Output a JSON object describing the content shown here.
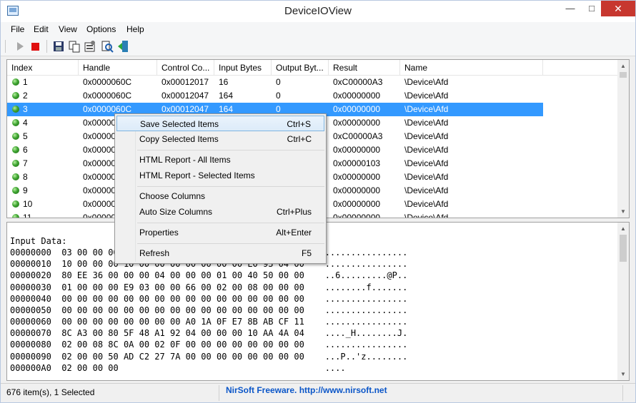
{
  "window": {
    "title": "DeviceIOView"
  },
  "menu": [
    "File",
    "Edit",
    "View",
    "Options",
    "Help"
  ],
  "toolbar": {
    "buttons": [
      "play-icon",
      "stop-icon",
      "save-icon",
      "copy-icon",
      "properties-icon",
      "find-icon",
      "exit-icon"
    ]
  },
  "list": {
    "columns": [
      "Index",
      "Handle",
      "Control Co...",
      "Input Bytes",
      "Output Byt...",
      "Result",
      "Name"
    ],
    "rows": [
      {
        "index": "1",
        "handle": "0x0000060C",
        "control": "0x00012017",
        "input": "16",
        "output": "0",
        "result": "0xC00000A3",
        "name": "\\Device\\Afd"
      },
      {
        "index": "2",
        "handle": "0x0000060C",
        "control": "0x00012047",
        "input": "164",
        "output": "0",
        "result": "0x00000000",
        "name": "\\Device\\Afd"
      },
      {
        "index": "3",
        "handle": "0x0000060C",
        "control": "0x00012047",
        "input": "164",
        "output": "0",
        "result": "0x00000000",
        "name": "\\Device\\Afd",
        "selected": true
      },
      {
        "index": "4",
        "handle": "0x000006",
        "control": "",
        "input": "",
        "output": "",
        "result": "0x00000000",
        "name": "\\Device\\Afd"
      },
      {
        "index": "5",
        "handle": "0x000006",
        "control": "",
        "input": "",
        "output": "",
        "result": "0xC00000A3",
        "name": "\\Device\\Afd"
      },
      {
        "index": "6",
        "handle": "0x000005",
        "control": "",
        "input": "",
        "output": "",
        "result": "0x00000000",
        "name": "\\Device\\Afd"
      },
      {
        "index": "7",
        "handle": "0x000005",
        "control": "",
        "input": "",
        "output": "",
        "result": "0x00000103",
        "name": "\\Device\\Afd"
      },
      {
        "index": "8",
        "handle": "0x000005",
        "control": "",
        "input": "",
        "output": "",
        "result": "0x00000000",
        "name": "\\Device\\Afd"
      },
      {
        "index": "9",
        "handle": "0x000007",
        "control": "",
        "input": "",
        "output": "",
        "result": "0x00000000",
        "name": "\\Device\\Afd"
      },
      {
        "index": "10",
        "handle": "0x000007",
        "control": "",
        "input": "",
        "output": "",
        "result": "0x00000000",
        "name": "\\Device\\Afd"
      },
      {
        "index": "11",
        "handle": "0x000007",
        "control": "",
        "input": "",
        "output": "",
        "result": "0x00000000",
        "name": "\\Device\\Afd"
      }
    ]
  },
  "hex": {
    "label": "Input Data:",
    "lines": [
      "00000000  03 00 00 00 00 00 00 00 00 00 00 00 00 00 00 00    ................",
      "00000010  10 00 00 00 10 00 00 00 00 00 00 00 E0 93 04 00    ................",
      "00000020  80 EE 36 00 00 00 04 00 00 00 01 00 40 50 00 00    ..6.........@P..",
      "00000030  01 00 00 00 E9 03 00 00 66 00 02 00 08 00 00 00    ........f.......",
      "00000040  00 00 00 00 00 00 00 00 00 00 00 00 00 00 00 00    ................",
      "00000050  00 00 00 00 00 00 00 00 00 00 00 00 00 00 00 00    ................",
      "00000060  00 00 00 00 00 00 00 00 A0 1A 0F E7 8B AB CF 11    ................",
      "00000070  8C A3 00 80 5F 48 A1 92 04 00 00 00 10 AA 4A 04    ...._H........J.",
      "00000080  02 00 08 8C 0A 00 02 0F 00 00 00 00 00 00 00 00    ................",
      "00000090  02 00 00 50 AD C2 27 7A 00 00 00 00 00 00 00 00    ...P..'z........",
      "000000A0  02 00 00 00                                        ...."
    ]
  },
  "status": {
    "count": "676 item(s), 1 Selected",
    "link": "NirSoft Freeware.  http://www.nirsoft.net"
  },
  "context_menu": [
    {
      "label": "Save Selected Items",
      "shortcut": "Ctrl+S",
      "highlight": true
    },
    {
      "label": "Copy Selected Items",
      "shortcut": "Ctrl+C"
    },
    {
      "label": "HTML Report - All Items",
      "shortcut": ""
    },
    {
      "label": "HTML Report - Selected Items",
      "shortcut": ""
    },
    {
      "label": "Choose Columns",
      "shortcut": ""
    },
    {
      "label": "Auto Size Columns",
      "shortcut": "Ctrl+Plus"
    },
    {
      "label": "Properties",
      "shortcut": "Alt+Enter"
    },
    {
      "label": "Refresh",
      "shortcut": "F5"
    }
  ]
}
